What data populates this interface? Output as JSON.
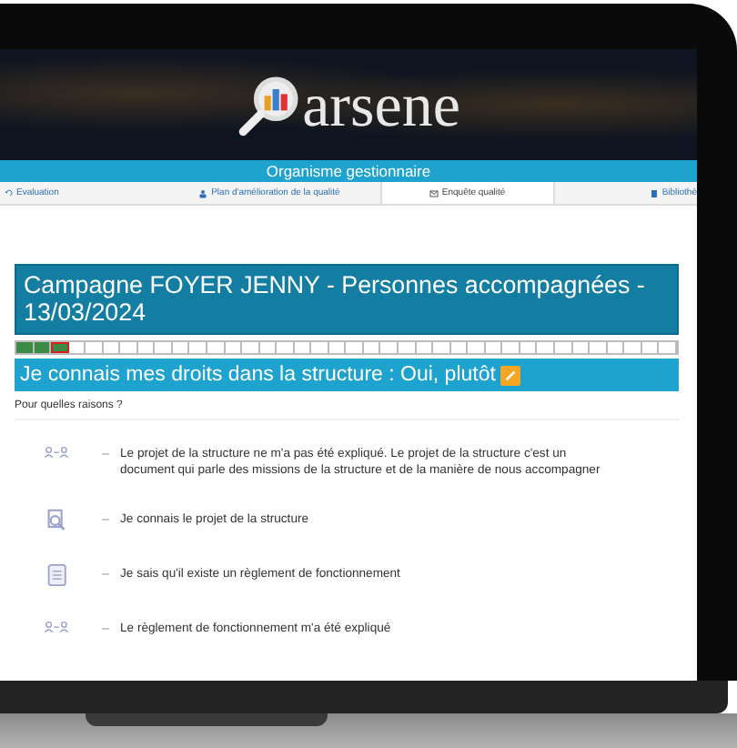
{
  "header": {
    "logo_text": "arsene"
  },
  "banner": {
    "title": "Organisme gestionnaire"
  },
  "tabs": [
    {
      "label": "Evaluation",
      "kind": "undo",
      "selected": false
    },
    {
      "label": "Plan d'amélioration de la qualité",
      "kind": "person",
      "selected": false
    },
    {
      "label": "Enquête qualité",
      "kind": "mail",
      "selected": true
    },
    {
      "label": "Bibliothè",
      "kind": "book",
      "selected": false
    }
  ],
  "campaign": {
    "title": "Campagne FOYER JENNY - Personnes accompagnées - 13/03/2024"
  },
  "progress_steps": [
    {
      "done": true,
      "current": false
    },
    {
      "done": true,
      "current": false
    },
    {
      "done": true,
      "current": true
    },
    {
      "done": false,
      "current": false
    },
    {
      "done": false,
      "current": false
    },
    {
      "done": false,
      "current": false
    },
    {
      "done": false,
      "current": false
    },
    {
      "done": false,
      "current": false
    },
    {
      "done": false,
      "current": false
    },
    {
      "done": false,
      "current": false
    },
    {
      "done": false,
      "current": false
    },
    {
      "done": false,
      "current": false
    },
    {
      "done": false,
      "current": false
    },
    {
      "done": false,
      "current": false
    },
    {
      "done": false,
      "current": false
    },
    {
      "done": false,
      "current": false
    },
    {
      "done": false,
      "current": false
    },
    {
      "done": false,
      "current": false
    },
    {
      "done": false,
      "current": false
    },
    {
      "done": false,
      "current": false
    },
    {
      "done": false,
      "current": false
    },
    {
      "done": false,
      "current": false
    },
    {
      "done": false,
      "current": false
    },
    {
      "done": false,
      "current": false
    },
    {
      "done": false,
      "current": false
    },
    {
      "done": false,
      "current": false
    },
    {
      "done": false,
      "current": false
    },
    {
      "done": false,
      "current": false
    },
    {
      "done": false,
      "current": false
    },
    {
      "done": false,
      "current": false
    },
    {
      "done": false,
      "current": false
    },
    {
      "done": false,
      "current": false
    },
    {
      "done": false,
      "current": false
    },
    {
      "done": false,
      "current": false
    },
    {
      "done": false,
      "current": false
    },
    {
      "done": false,
      "current": false
    },
    {
      "done": false,
      "current": false
    },
    {
      "done": false,
      "current": false
    }
  ],
  "question": {
    "text": "Je connais mes droits dans la structure : Oui, plutôt"
  },
  "reasons": {
    "label": "Pour quelles raisons ?",
    "items": [
      {
        "kind": "people-link",
        "text": "Le projet de la structure ne m'a pas été expliqué. Le projet de la structure c'est un document qui parle des missions de la structure et de la manière de nous accompagner"
      },
      {
        "kind": "search-doc",
        "text": "Je connais le projet de la structure"
      },
      {
        "kind": "document",
        "text": "Je sais qu'il existe un règlement de fonctionnement"
      },
      {
        "kind": "people-link",
        "text": "Le règlement de fonctionnement m'a été expliqué"
      }
    ]
  }
}
